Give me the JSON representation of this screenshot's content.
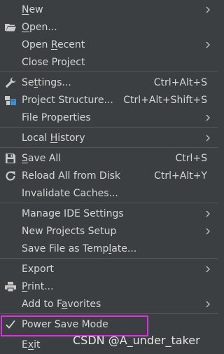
{
  "menu": {
    "new": {
      "label": "New",
      "mnemonic": "N",
      "rest": "ew"
    },
    "open": {
      "label": "Open...",
      "mnemonic": "O",
      "rest": "pen..."
    },
    "open_recent": {
      "label": "Open Recent",
      "pre": "Open ",
      "mnemonic": "R",
      "rest": "ecent"
    },
    "close_project": {
      "label": "Close Project"
    },
    "settings": {
      "label": "Settings...",
      "pre": "Se",
      "mnemonic": "t",
      "rest": "tings...",
      "shortcut": "Ctrl+Alt+S"
    },
    "project_structure": {
      "label": "Project Structure...",
      "shortcut": "Ctrl+Alt+Shift+S"
    },
    "file_properties": {
      "label": "File Properties"
    },
    "local_history": {
      "label": "Local History",
      "pre": "Local ",
      "mnemonic": "H",
      "rest": "istory"
    },
    "save_all": {
      "label": "Save All",
      "mnemonic": "S",
      "rest": "ave All",
      "shortcut": "Ctrl+S"
    },
    "reload_all": {
      "label": "Reload All from Disk",
      "shortcut": "Ctrl+Alt+Y"
    },
    "invalidate_caches": {
      "label": "Invalidate Caches..."
    },
    "manage_ide_settings": {
      "label": "Manage IDE Settings"
    },
    "new_projects_setup": {
      "label": "New Projects Setup"
    },
    "save_as_template": {
      "label": "Save File as Template...",
      "pre": "Save File as Temp",
      "mnemonic": "l",
      "rest": "ate..."
    },
    "export": {
      "label": "Export"
    },
    "print": {
      "label": "Print...",
      "mnemonic": "P",
      "rest": "rint..."
    },
    "add_to_favorites": {
      "label": "Add to Favorites",
      "pre": "Add to F",
      "mnemonic": "a",
      "rest": "vorites"
    },
    "power_save_mode": {
      "label": "Power Save Mode",
      "checked": true
    },
    "exit": {
      "label": "Exit",
      "pre": "E",
      "mnemonic": "x",
      "rest": "it"
    }
  },
  "watermark": "CSDN @A_under_taker",
  "icons": {
    "open": "folder-open-icon",
    "settings": "wrench-icon",
    "project_structure": "project-structure-icon",
    "save_all": "floppy-disk-icon",
    "reload_all": "reload-icon",
    "print": "printer-icon",
    "power_save_mode": "checkmark-icon",
    "submenu": "chevron-right-icon"
  },
  "colors": {
    "menu_background": "#3c3f41",
    "text": "#d6d6d6",
    "separator": "#555859",
    "highlight_box": "#e12ee6",
    "icon_blue": "#3d8fd6"
  }
}
